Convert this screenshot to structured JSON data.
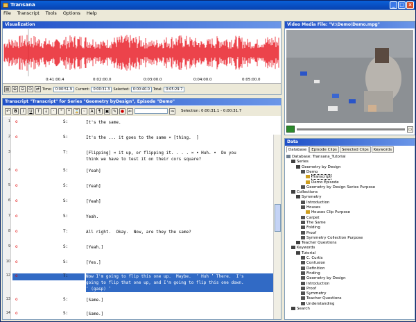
{
  "window": {
    "title": "Transana"
  },
  "menu": [
    "File",
    "Transcript",
    "Tools",
    "Options",
    "Help"
  ],
  "visualization": {
    "title": "Visualization",
    "ticks": [
      "0:41:00.4",
      "0:02:00.0",
      "0:03:00.0",
      "0:04:00.0",
      "0:05:00.0"
    ],
    "time_label": "Time:",
    "time_value": "0:00:51.9",
    "current_label": "Current:",
    "current_value": "0:00:31.3",
    "selected_label": "Selected:",
    "selected_value": "0:00:40.0",
    "total_label": "Total:",
    "total_value": "0:05:29.7"
  },
  "transcript": {
    "title": "Transcript \"Transcript\" for Series \"Geometry byDesign\", Episode \"Demo\"",
    "selection": "Selection: 0:00:31.1 - 0:00:31.7",
    "rows": [
      {
        "ln": "1",
        "mark": "o",
        "sp": "S:",
        "text": "It's the same."
      },
      {
        "ln": "2",
        "mark": "o",
        "sp": "S:",
        "text": "It's the ... it goes to the same ¤ [thing.  ]"
      },
      {
        "ln": "3",
        "mark": "",
        "sp": "T:",
        "text": "[Flipping] ¤ it up, or flipping it. . . . ¤ • Huh. •  Do you\nthink we have to test it on their cors square?"
      },
      {
        "ln": "4",
        "mark": "o",
        "sp": "S:",
        "text": "[Yeah]"
      },
      {
        "ln": "5",
        "mark": "o",
        "sp": "S:",
        "text": "[Yeah]"
      },
      {
        "ln": "6",
        "mark": "o",
        "sp": "S:",
        "text": "[Yeah]"
      },
      {
        "ln": "7",
        "mark": "o",
        "sp": "S:",
        "text": "Yeah."
      },
      {
        "ln": "8",
        "mark": "o",
        "sp": "T:",
        "text": "All right.  Okay.  Now, are they the same?"
      },
      {
        "ln": "9",
        "mark": "o",
        "sp": "S:",
        "text": "[Yeah.]"
      },
      {
        "ln": "10",
        "mark": "o",
        "sp": "S:",
        "text": "[Yes.]"
      },
      {
        "ln": "12",
        "mark": "o",
        "sp": "T:",
        "text": "Now I'm going to flip this one up.  Maybe.  ‘ Huh ’ There.  I's\ngoing to flip that one up, and I'm going to flip this one down.\n‘ (gasp) ’"
      },
      {
        "ln": "13",
        "mark": "o",
        "sp": "S:",
        "text": "[Same.]"
      },
      {
        "ln": "14",
        "mark": "o",
        "sp": "S:",
        "text": "[Same.]"
      }
    ]
  },
  "video": {
    "title": "Video Media File: \"V:\\Demo\\Demo.mpg\""
  },
  "data_panel": {
    "title": "Data",
    "tabs": [
      "Database",
      "Episode Clips",
      "Selected Clips",
      "Keywords"
    ],
    "tree": [
      {
        "t": "Database: Transana_Tutorial",
        "d": 0
      },
      {
        "t": "Series",
        "d": 1
      },
      {
        "t": "Geometry by Design",
        "d": 2
      },
      {
        "t": "Demo",
        "d": 3
      },
      {
        "t": "Transcript",
        "d": 4
      },
      {
        "t": "Demo Episode",
        "d": 4
      },
      {
        "t": "Geometry by Design Series Purpose",
        "d": 3
      },
      {
        "t": "Collections",
        "d": 1
      },
      {
        "t": "Symmetry",
        "d": 2
      },
      {
        "t": "Introduction",
        "d": 3
      },
      {
        "t": "Houses",
        "d": 3
      },
      {
        "t": "Houses Clip Purpose",
        "d": 4
      },
      {
        "t": "Carpet",
        "d": 3
      },
      {
        "t": "The Same",
        "d": 3
      },
      {
        "t": "Folding",
        "d": 3
      },
      {
        "t": "Proof",
        "d": 3
      },
      {
        "t": "Symmetry Collection Purpose",
        "d": 3
      },
      {
        "t": "Teacher Questions",
        "d": 2
      },
      {
        "t": "Keywords",
        "d": 1
      },
      {
        "t": "Tutorial",
        "d": 2
      },
      {
        "t": "C. Curtis",
        "d": 3
      },
      {
        "t": "Confusion",
        "d": 3
      },
      {
        "t": "Definition",
        "d": 3
      },
      {
        "t": "Finding",
        "d": 3
      },
      {
        "t": "Geometry by Design",
        "d": 3
      },
      {
        "t": "Introduction",
        "d": 3
      },
      {
        "t": "Proof",
        "d": 3
      },
      {
        "t": "Symmetry",
        "d": 3
      },
      {
        "t": "Teacher Questions",
        "d": 3
      },
      {
        "t": "Understanding",
        "d": 3
      },
      {
        "t": "Search",
        "d": 1
      }
    ]
  },
  "colors": {
    "waveform": "#e8141e",
    "selection": "#316ac5",
    "title_bar": "#0a5fd8"
  }
}
